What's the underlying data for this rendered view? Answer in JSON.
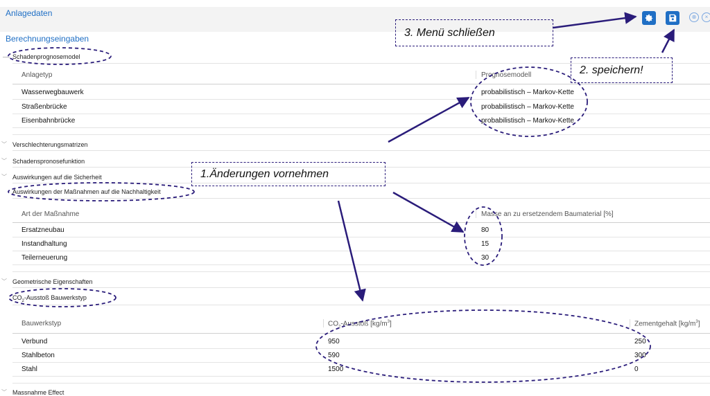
{
  "header": {
    "anlagedaten": "Anlagedaten",
    "berechnungseingaben": "Berechnungseingaben"
  },
  "toolbar": {
    "settings_icon": "gear-icon",
    "save_icon": "save-icon",
    "accent": "#1f6fc5"
  },
  "sections": {
    "schaden": "Schadenprognosemodel",
    "verschlechterung": "Verschlechterungsmatrizen",
    "schadensprognose": "Schadenspronosefunktion",
    "sicherheit": "Auswirkungen auf die Sicherheit",
    "nachhaltigkeit": "Auswirkungen der Maßnahmen auf die Nachhaltigkeit",
    "geometrie": "Geometrische Eigenschaften",
    "co2_prefix": "CO",
    "co2_sub": "2",
    "co2_suffix": "-Ausstoß Bauwerkstyp",
    "massnahme": "Massnahme Effect"
  },
  "prognose_table": {
    "col1": "Anlagetyp",
    "col2": "Prognosemodell",
    "rows": [
      {
        "typ": "Wasserwegbauwerk",
        "modell": "probabilistisch – Markov-Kette"
      },
      {
        "typ": "Straßenbrücke",
        "modell": "probabilistisch – Markov-Kette"
      },
      {
        "typ": "Eisenbahnbrücke",
        "modell": "probabilistisch – Markov-Kette"
      }
    ]
  },
  "massnahmen_table": {
    "col1": "Art der Maßnahme",
    "col2": "Masse an zu ersetzendem Baumaterial [%]",
    "rows": [
      {
        "art": "Ersatzneubau",
        "wert": "80"
      },
      {
        "art": "Instandhaltung",
        "wert": "15"
      },
      {
        "art": "Teilerneuerung",
        "wert": "30"
      }
    ]
  },
  "co2_table": {
    "col1": "Bauwerkstyp",
    "col2_prefix": "CO",
    "col2_sub": "2",
    "col2_mid": "-Ausstoß [kg/m",
    "col2_sup": "3",
    "col2_suffix": "]",
    "col3_prefix": "Zementgehalt [kg/m",
    "col3_sup": "3",
    "col3_suffix": "]",
    "rows": [
      {
        "typ": "Verbund",
        "co2": "950",
        "zement": "250"
      },
      {
        "typ": "Stahlbeton",
        "co2": "590",
        "zement": "300"
      },
      {
        "typ": "Stahl",
        "co2": "1500",
        "zement": "0"
      }
    ]
  },
  "annotations": {
    "step1": "1.Änderungen vornehmen",
    "step2": "2. speichern!",
    "step3": "3. Menü schließen",
    "color": "#2a1c7a"
  }
}
